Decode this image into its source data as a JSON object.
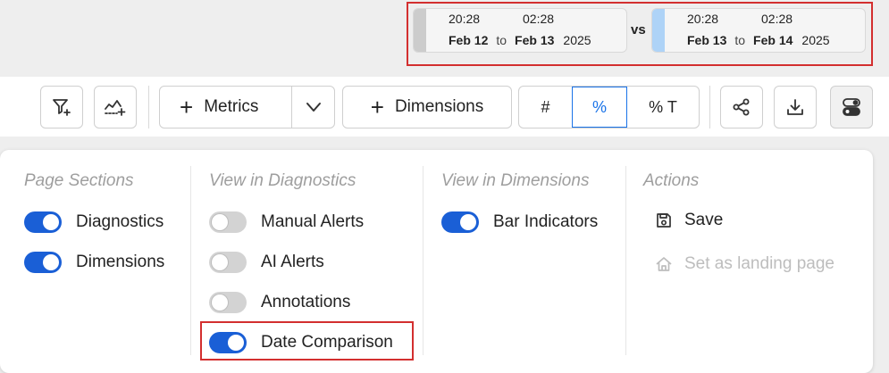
{
  "date_comparison": {
    "primary": {
      "start_time": "20:28",
      "end_time": "02:28",
      "start_date": "Feb 12",
      "to": "to",
      "end_date": "Feb 13",
      "year": "2025",
      "color": "#cccccc"
    },
    "vs_label": "vs",
    "comparison": {
      "start_time": "20:28",
      "end_time": "02:28",
      "start_date": "Feb 13",
      "to": "to",
      "end_date": "Feb 14",
      "year": "2025",
      "color": "#aed3f7"
    }
  },
  "toolbar": {
    "metrics_label": "Metrics",
    "dimensions_label": "Dimensions",
    "display_modes": [
      "#",
      "%",
      "% T"
    ],
    "active_mode": "%",
    "icons": [
      "filter-add-icon",
      "anomaly-add-icon",
      "chevron-down-icon",
      "share-icon",
      "download-icon",
      "settings-toggle-icon"
    ]
  },
  "panel": {
    "sections": [
      {
        "heading": "Page Sections",
        "items": [
          {
            "label": "Diagnostics",
            "on": true
          },
          {
            "label": "Dimensions",
            "on": true
          }
        ]
      },
      {
        "heading": "View in Diagnostics",
        "items": [
          {
            "label": "Manual Alerts",
            "on": false
          },
          {
            "label": "AI Alerts",
            "on": false
          },
          {
            "label": "Annotations",
            "on": false
          },
          {
            "label": "Date Comparison",
            "on": true
          }
        ]
      },
      {
        "heading": "View in Dimensions",
        "items": [
          {
            "label": "Bar Indicators",
            "on": true
          }
        ]
      },
      {
        "heading": "Actions",
        "items": [
          {
            "label": "Save",
            "icon": "save-icon",
            "enabled": true
          },
          {
            "label": "Set as landing page",
            "icon": "home-icon",
            "enabled": false
          }
        ]
      }
    ]
  },
  "colors": {
    "accent": "#1a5fd6",
    "highlight": "#d32f2f",
    "toggle_off": "#d3d3d3"
  }
}
